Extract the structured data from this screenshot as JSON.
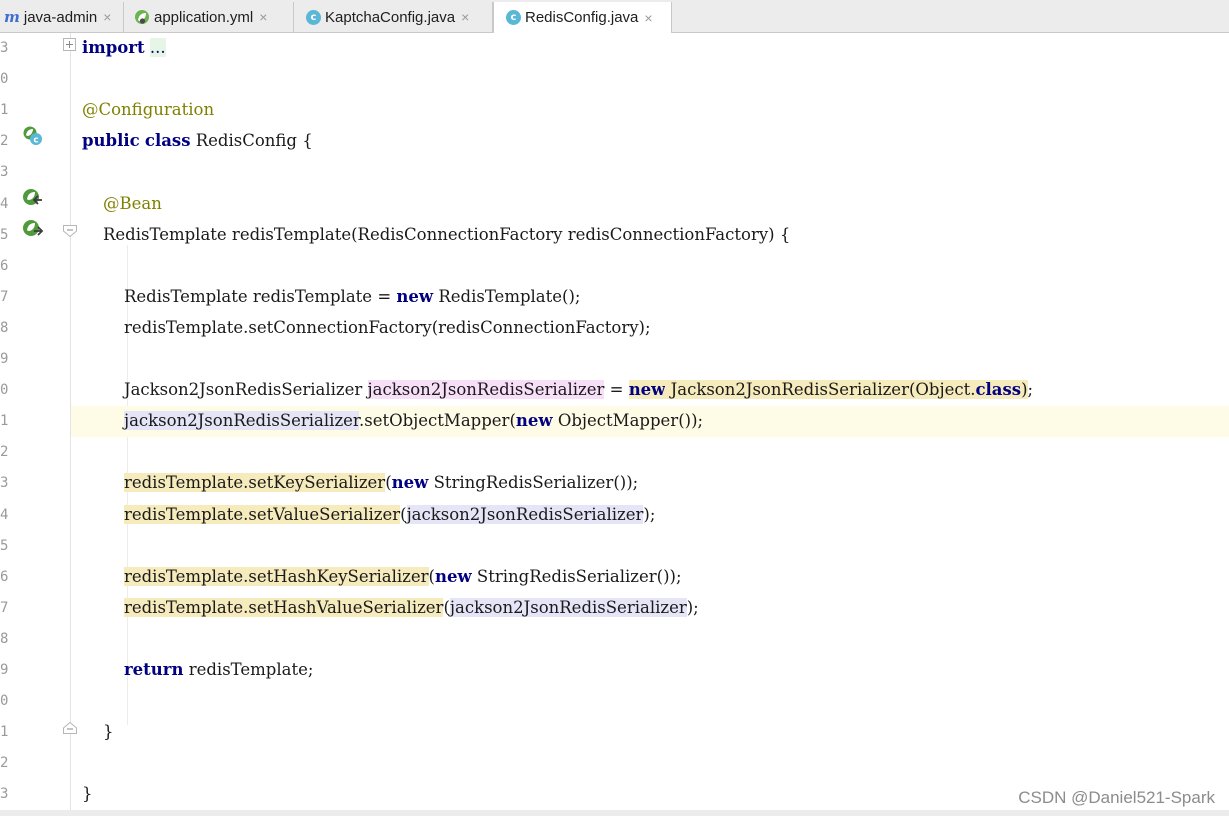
{
  "tabs": [
    {
      "label": "java-admin",
      "icon": "maven-m-icon",
      "active": false
    },
    {
      "label": "application.yml",
      "icon": "spring-leaf-icon",
      "active": false
    },
    {
      "label": "KaptchaConfig.java",
      "icon": "java-class-icon",
      "active": false
    },
    {
      "label": "RedisConfig.java",
      "icon": "java-class-icon",
      "active": true
    }
  ],
  "close_glyph": "×",
  "class_icon_letter": "c",
  "lines": [
    {
      "num": "3",
      "tokens": [
        {
          "t": "import",
          "c": "kw"
        },
        {
          "t": " "
        },
        {
          "t": "...",
          "c": "fold-hl"
        }
      ]
    },
    {
      "num": "0",
      "tokens": []
    },
    {
      "num": "1",
      "tokens": [
        {
          "t": "@Configuration",
          "c": "ann"
        }
      ]
    },
    {
      "num": "2",
      "tokens": [
        {
          "t": "public",
          "c": "kw"
        },
        {
          "t": " "
        },
        {
          "t": "class",
          "c": "kw"
        },
        {
          "t": " RedisConfig {"
        }
      ]
    },
    {
      "num": "3",
      "tokens": []
    },
    {
      "num": "4",
      "tokens": [
        {
          "t": "    "
        },
        {
          "t": "@Bean",
          "c": "ann"
        }
      ]
    },
    {
      "num": "5",
      "tokens": [
        {
          "t": "    RedisTemplate redisTemplate(RedisConnectionFactory redisConnectionFactory) {"
        }
      ]
    },
    {
      "num": "6",
      "tokens": []
    },
    {
      "num": "7",
      "tokens": [
        {
          "t": "        RedisTemplate redisTemplate = "
        },
        {
          "t": "new",
          "c": "kw"
        },
        {
          "t": " RedisTemplate();"
        }
      ]
    },
    {
      "num": "8",
      "tokens": [
        {
          "t": "        redisTemplate.setConnectionFactory(redisConnectionFactory);"
        }
      ]
    },
    {
      "num": "9",
      "tokens": []
    },
    {
      "num": "0",
      "tokens": [
        {
          "t": "        Jackson2JsonRedisSerializer "
        },
        {
          "t": "jackson2JsonRedisSerializer",
          "c": "hl-p"
        },
        {
          "t": " = "
        },
        {
          "t": "new",
          "c": "kw hl-y"
        },
        {
          "t": " Jackson2JsonRedisSerializer(Object.",
          "c": "hl-y"
        },
        {
          "t": "class",
          "c": "kw hl-y"
        },
        {
          "t": ")",
          "c": "hl-y"
        },
        {
          "t": ";"
        }
      ]
    },
    {
      "num": "1",
      "current": true,
      "tokens": [
        {
          "t": "        "
        },
        {
          "t": "jackson2JsonRedisSerializer",
          "c": "hl-b"
        },
        {
          "t": ".setObjectMapper("
        },
        {
          "t": "new",
          "c": "kw"
        },
        {
          "t": " ObjectMapper());"
        }
      ]
    },
    {
      "num": "2",
      "tokens": []
    },
    {
      "num": "3",
      "tokens": [
        {
          "t": "        "
        },
        {
          "t": "redisTemplate.setKeySerializer",
          "c": "hl-y"
        },
        {
          "t": "("
        },
        {
          "t": "new",
          "c": "kw"
        },
        {
          "t": " StringRedisSerializer());"
        }
      ]
    },
    {
      "num": "4",
      "tokens": [
        {
          "t": "        "
        },
        {
          "t": "redisTemplate.setValueSerializer",
          "c": "hl-y"
        },
        {
          "t": "("
        },
        {
          "t": "jackson2JsonRedisSerializer",
          "c": "hl-b"
        },
        {
          "t": ");"
        }
      ]
    },
    {
      "num": "5",
      "tokens": []
    },
    {
      "num": "6",
      "tokens": [
        {
          "t": "        "
        },
        {
          "t": "redisTemplate.setHashKeySerializer",
          "c": "hl-y"
        },
        {
          "t": "("
        },
        {
          "t": "new",
          "c": "kw"
        },
        {
          "t": " StringRedisSerializer());"
        }
      ]
    },
    {
      "num": "7",
      "tokens": [
        {
          "t": "        "
        },
        {
          "t": "redisTemplate.setHashValueSerializer",
          "c": "hl-y"
        },
        {
          "t": "("
        },
        {
          "t": "jackson2JsonRedisSerializer",
          "c": "hl-b"
        },
        {
          "t": ");"
        }
      ]
    },
    {
      "num": "8",
      "tokens": []
    },
    {
      "num": "9",
      "tokens": [
        {
          "t": "        "
        },
        {
          "t": "return",
          "c": "kw"
        },
        {
          "t": " redisTemplate;"
        }
      ]
    },
    {
      "num": "0",
      "tokens": []
    },
    {
      "num": "1",
      "tokens": [
        {
          "t": "    }"
        }
      ]
    },
    {
      "num": "2",
      "tokens": []
    },
    {
      "num": "3",
      "tokens": [
        {
          "t": "}"
        }
      ]
    }
  ],
  "watermark": "CSDN @Daniel521-Spark",
  "colors": {
    "keyword": "#000080",
    "annotation": "#808000",
    "highlight_yellow": "#f6ebbc",
    "highlight_pink": "#f7dff7",
    "highlight_blue": "#e5e5f7",
    "current_line": "#fefbe6"
  }
}
